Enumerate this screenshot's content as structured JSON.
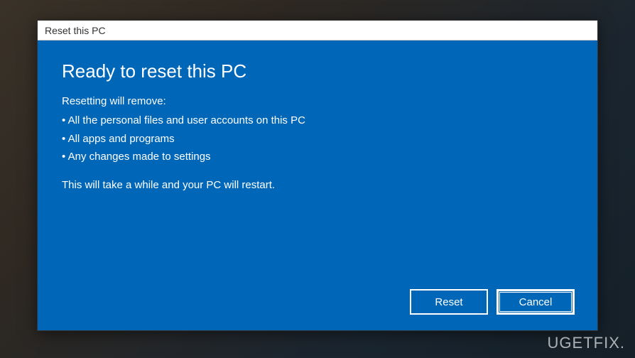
{
  "dialog": {
    "title": "Reset this PC",
    "heading": "Ready to reset this PC",
    "subheading": "Resetting will remove:",
    "bullets": [
      "• All the personal files and user accounts on this PC",
      "• All apps and programs",
      "• Any changes made to settings"
    ],
    "note": "This will take a while and your PC will restart.",
    "buttons": {
      "reset": "Reset",
      "cancel": "Cancel"
    }
  },
  "watermark": "UGETFIX."
}
